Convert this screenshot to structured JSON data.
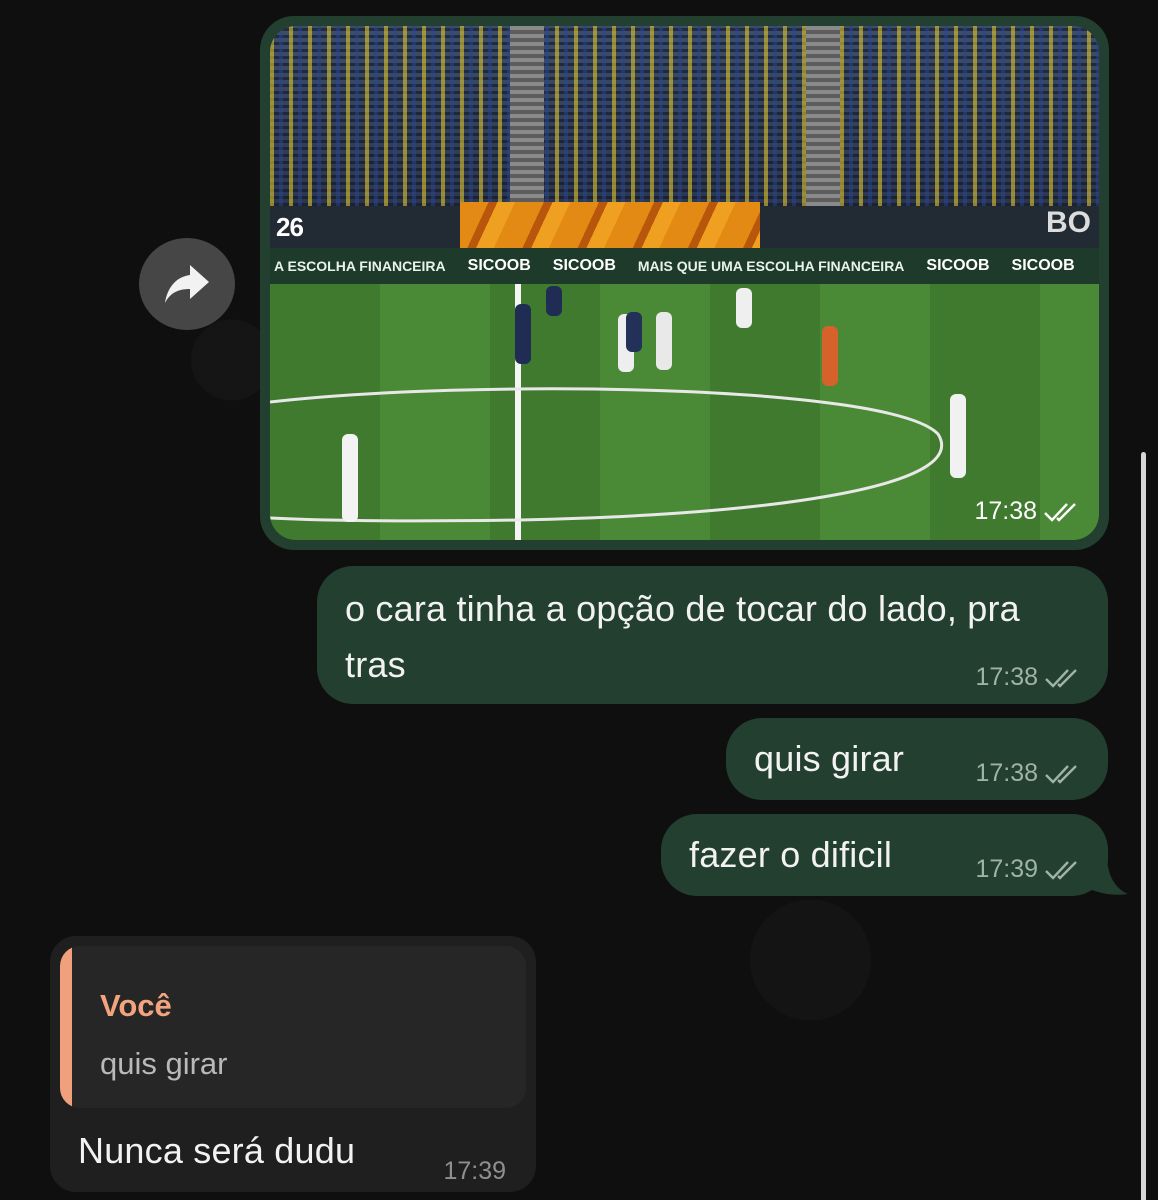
{
  "media_message": {
    "time": "17:38",
    "status_icon": "double-check-icon",
    "video_overlay": {
      "score_left": "26",
      "score_right": "BO",
      "board_texts": [
        "A ESCOLHA FINANCEIRA",
        "SICOOB",
        "SICOOB",
        "MAIS QUE UMA ESCOLHA FINANCEIRA",
        "SICOOB",
        "SICOOB"
      ]
    }
  },
  "forward_button": {
    "icon": "forward-arrow-icon"
  },
  "messages_out": [
    {
      "text": "o cara tinha a opção de tocar do lado, pra tras",
      "time": "17:38",
      "status_icon": "double-check-icon"
    },
    {
      "text": "quis girar",
      "time": "17:38",
      "status_icon": "double-check-icon"
    },
    {
      "text": "fazer o dificil",
      "time": "17:39",
      "status_icon": "double-check-icon"
    }
  ],
  "message_in": {
    "reply_to": {
      "name": "Você",
      "text": "quis girar"
    },
    "text": "Nunca será dudu",
    "time": "17:39"
  },
  "colors": {
    "outgoing_bubble": "#233f30",
    "incoming_bubble": "#1f1f1f",
    "reply_accent": "#f0a07c",
    "background": "#0f0f0f"
  }
}
